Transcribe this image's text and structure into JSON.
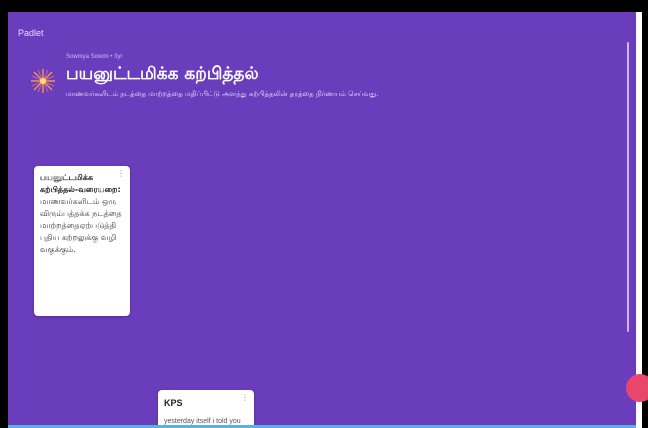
{
  "app": {
    "brand": "Padlet"
  },
  "header": {
    "meta": "Sowmya Sowmi • 3yr",
    "title": "பயனுட்டமிக்க கற்பித்தல்",
    "description": "மாணவர்களிடம் நடத்தை மாற்றத்தை மதிப்பிட்டு அளந்து கற்பித்தலின் தரத்தை நிர்ணயம் செய்வது."
  },
  "posts": [
    {
      "head": "பயனுட்டமிக்க கற்பித்தல்-வரையறை:",
      "body": "மாணவர்களிடம் ஒரு விரும்பத்தக்க நடத்தை மாற்றத்தைஏற்படுத்தி புதிய கற்றலுக்கு வழி வகுக்கும்.",
      "menu": "⋮"
    },
    {
      "title": "KPS",
      "body": "yesterday itself i told you",
      "menu": "⋮"
    }
  ],
  "colors": {
    "board_bg": "#6a3dbd",
    "accent": "#f08a24",
    "fab": "#e8466a"
  },
  "icons": {
    "avatar": "sun-burst-icon",
    "card_menu": "more-vert-icon"
  }
}
